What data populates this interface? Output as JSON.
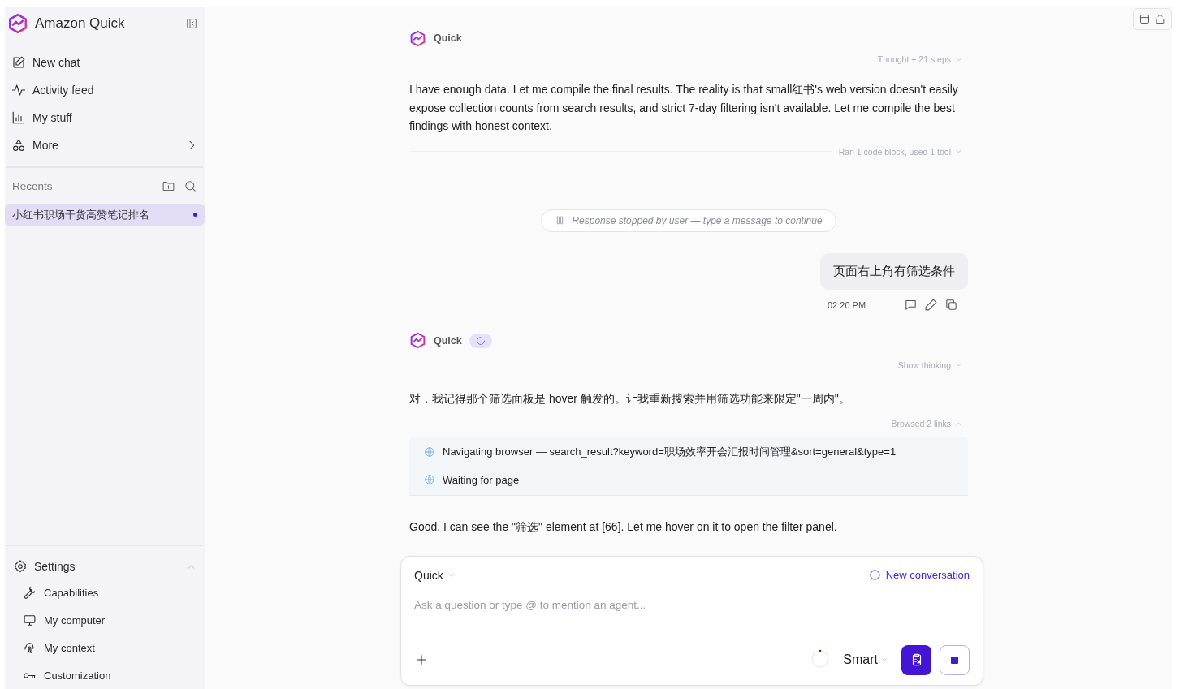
{
  "sidebar": {
    "title": "Amazon Quick",
    "nav": [
      {
        "label": "New chat",
        "submenu": false
      },
      {
        "label": "Activity feed",
        "submenu": false
      },
      {
        "label": "My stuff",
        "submenu": false
      },
      {
        "label": "More",
        "submenu": true
      }
    ],
    "recents": {
      "title": "Recents",
      "items": [
        {
          "label": "小红书职场干货高赞笔记排名",
          "selected": true,
          "unread": true
        }
      ]
    },
    "settings": {
      "label": "Settings",
      "expanded": true,
      "items": [
        "Capabilities",
        "My computer",
        "My context",
        "Customization"
      ]
    }
  },
  "messages": [
    {
      "kind": "assistant",
      "name": "Quick",
      "busy": false,
      "thinking": {
        "label": "Thought + 21 steps",
        "expanded": false
      },
      "blocks": [
        {
          "kind": "text",
          "text": "I have enough data. Let me compile the final results. The reality is that small红书's web version doesn't easily expose collection counts from search results, and strict 7-day filtering isn't available. Let me compile the best findings with honest context."
        },
        {
          "kind": "summary",
          "label": "Ran 1 code block, used 1 tool",
          "expanded": false
        }
      ]
    },
    {
      "kind": "notice",
      "text": "Response stopped by user — type a message to continue"
    },
    {
      "kind": "user",
      "text": "页面右上角有筛选条件",
      "time": "02:20 PM"
    },
    {
      "kind": "assistant",
      "name": "Quick",
      "busy": true,
      "thinking": {
        "label": "Show thinking",
        "expanded": false
      },
      "blocks": [
        {
          "kind": "text",
          "text": "对，我记得那个筛选面板是 hover 触发的。让我重新搜索并用筛选功能来限定\"一周内\"。"
        },
        {
          "kind": "activity",
          "label": "Browsed 2 links",
          "expanded": true,
          "steps": [
            "Navigating browser — search_result?keyword=职场效率开会汇报时间管理&sort=general&type=1",
            "Waiting for page"
          ]
        },
        {
          "kind": "text",
          "text": "Good, I can see the \"筛选\" element at [66]. Let me hover on it to open the filter panel."
        }
      ]
    }
  ],
  "composer": {
    "agent": "Quick",
    "action": "New conversation",
    "placeholder": "Ask a question or type @ to mention an agent...",
    "mode": "Smart",
    "running": true
  }
}
